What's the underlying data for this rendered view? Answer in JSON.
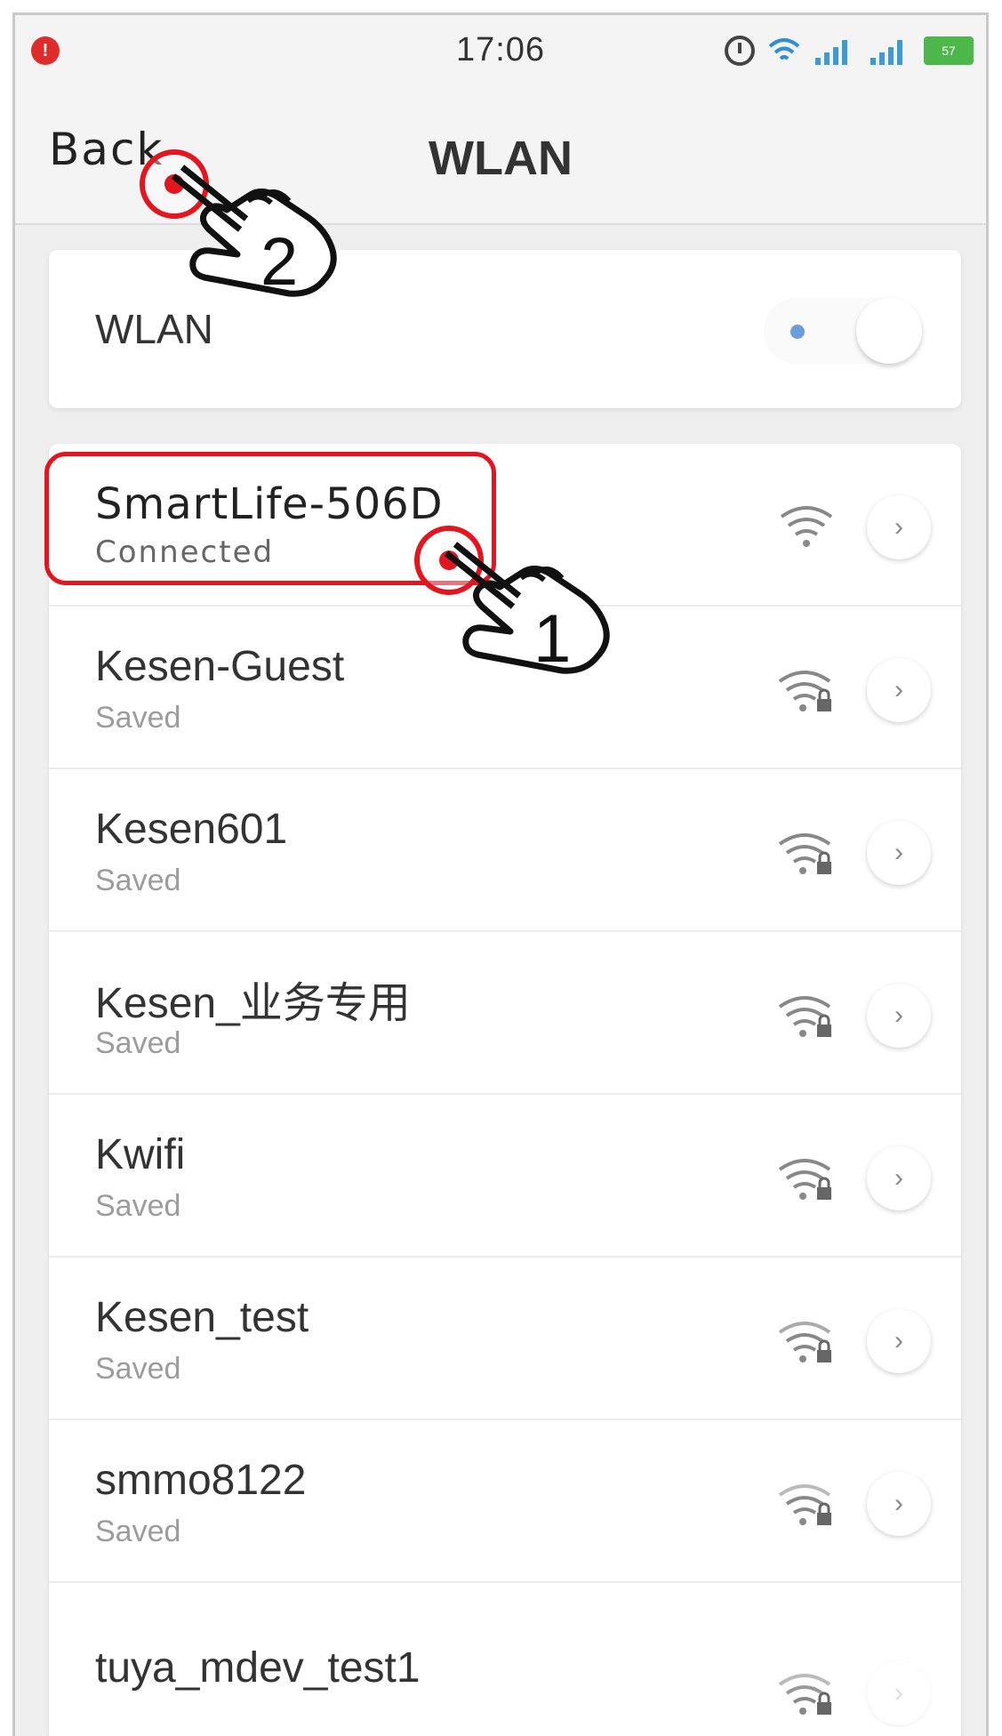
{
  "status_bar": {
    "time": "17:06",
    "notification_badge": "!",
    "battery": "57"
  },
  "nav": {
    "back_label": "Back",
    "title": "WLAN"
  },
  "wlan_toggle": {
    "label": "WLAN",
    "state": "on"
  },
  "networks": [
    {
      "name": "SmartLife-506D",
      "status": "Connected",
      "secured": false
    },
    {
      "name": "Kesen-Guest",
      "status": "Saved",
      "secured": true
    },
    {
      "name": "Kesen601",
      "status": "Saved",
      "secured": true
    },
    {
      "name": "Kesen_业务专用",
      "status": "Saved",
      "secured": true
    },
    {
      "name": "Kwifi",
      "status": "Saved",
      "secured": true
    },
    {
      "name": "Kesen_test",
      "status": "Saved",
      "secured": true
    },
    {
      "name": "smmo8122",
      "status": "Saved",
      "secured": true
    },
    {
      "name": "tuya_mdev_test1",
      "status": "",
      "secured": true
    }
  ],
  "annotations": {
    "step1": "1",
    "step2": "2"
  },
  "colors": {
    "accent_red": "#e3161f",
    "toggle_dot": "#6a9ed8"
  }
}
